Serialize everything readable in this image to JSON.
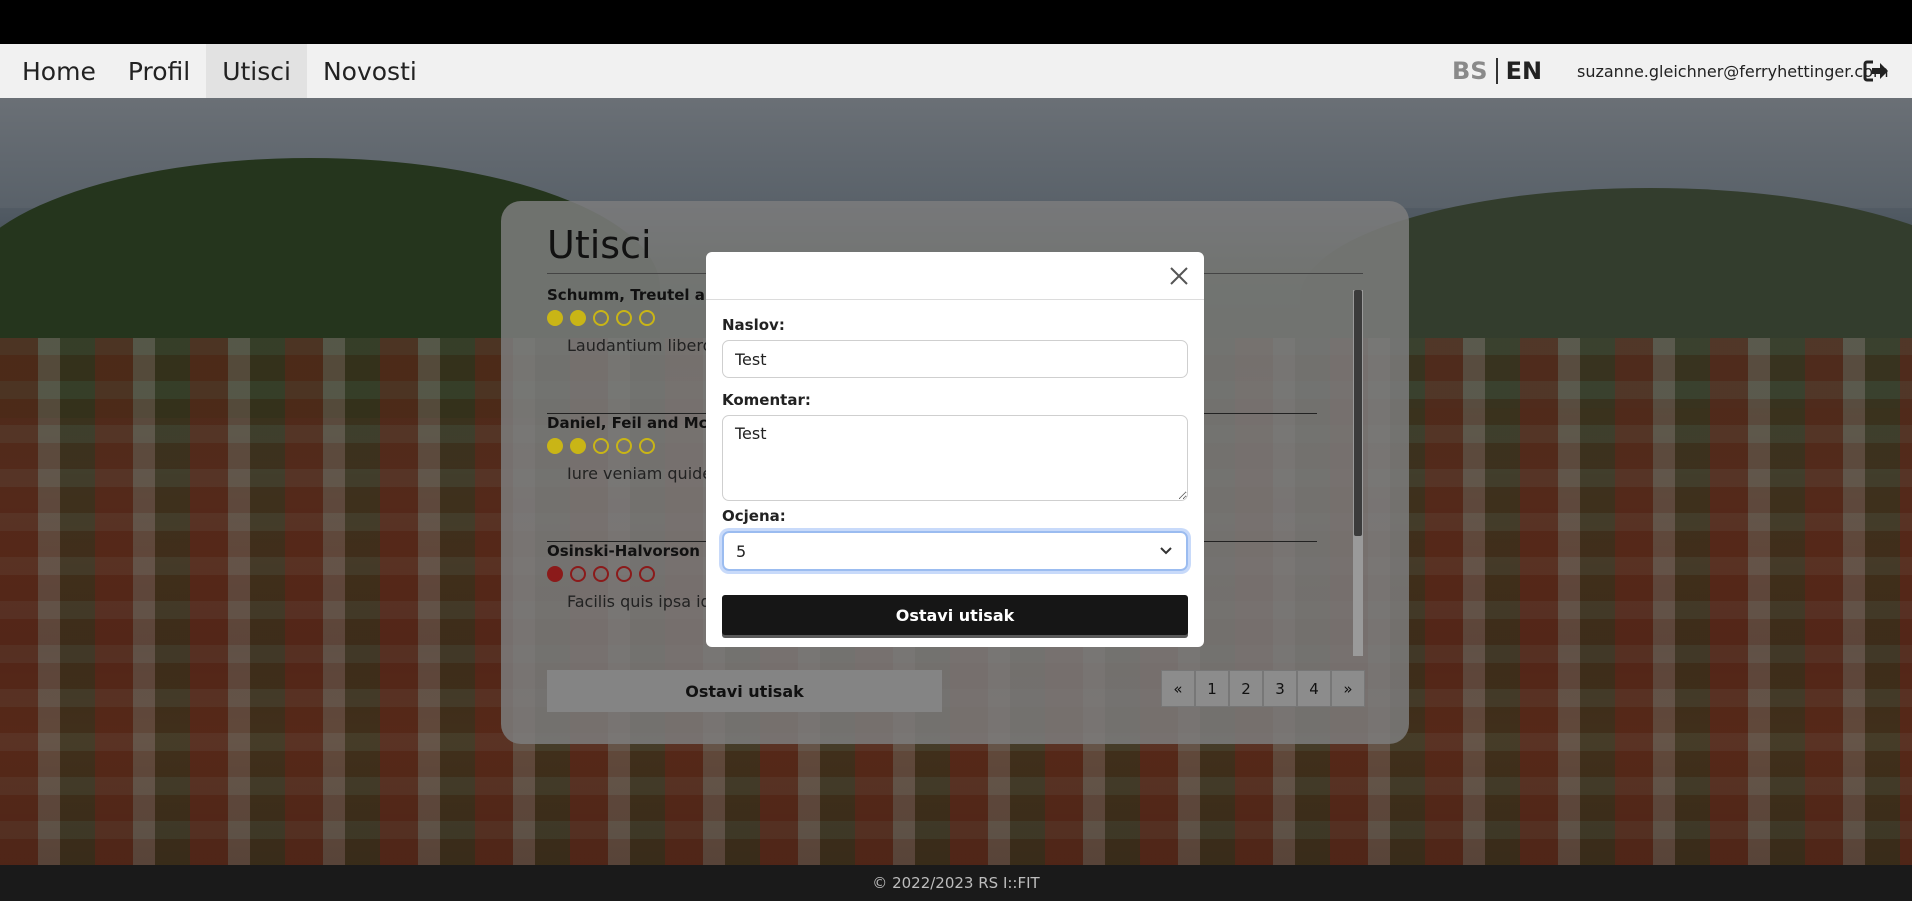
{
  "nav": {
    "items": [
      "Home",
      "Profil",
      "Utisci",
      "Novosti"
    ],
    "active": "Utisci",
    "lang_bs": "BS",
    "lang_en": "EN",
    "user_email": "suzanne.gleichner@ferryhettinger.com"
  },
  "panel": {
    "title": "Utisci",
    "reviews": [
      {
        "author": "Schumm, Treutel and",
        "rating": 2,
        "star_color": "#c9b516",
        "text": "Laudantium libero v                                                                                                ipsum ut sint quo vel incidunt. Cu                                                                                          s."
      },
      {
        "author": "Daniel, Feil and McCl",
        "rating": 2,
        "star_color": "#c9b516",
        "text": "Iure veniam quidem                                                                                                sapiente qui officiis. Illo impedit"
      },
      {
        "author": "Osinski-Halvorson",
        "rating": 1,
        "star_color": "#8b1a1a",
        "text": "Facilis quis ipsa id e                                                                                            m porro. Omnis iure delenit"
      }
    ],
    "button_label": "Ostavi utisak",
    "pager": [
      "«",
      "1",
      "2",
      "3",
      "4",
      "»"
    ]
  },
  "modal": {
    "title_label": "Naslov:",
    "title_value": "Test",
    "comment_label": "Komentar:",
    "comment_value": "Test",
    "rating_label": "Ocjena:",
    "rating_value": "5",
    "submit_label": "Ostavi utisak"
  },
  "footer": {
    "text": "© 2022/2023 RS I::FIT"
  }
}
